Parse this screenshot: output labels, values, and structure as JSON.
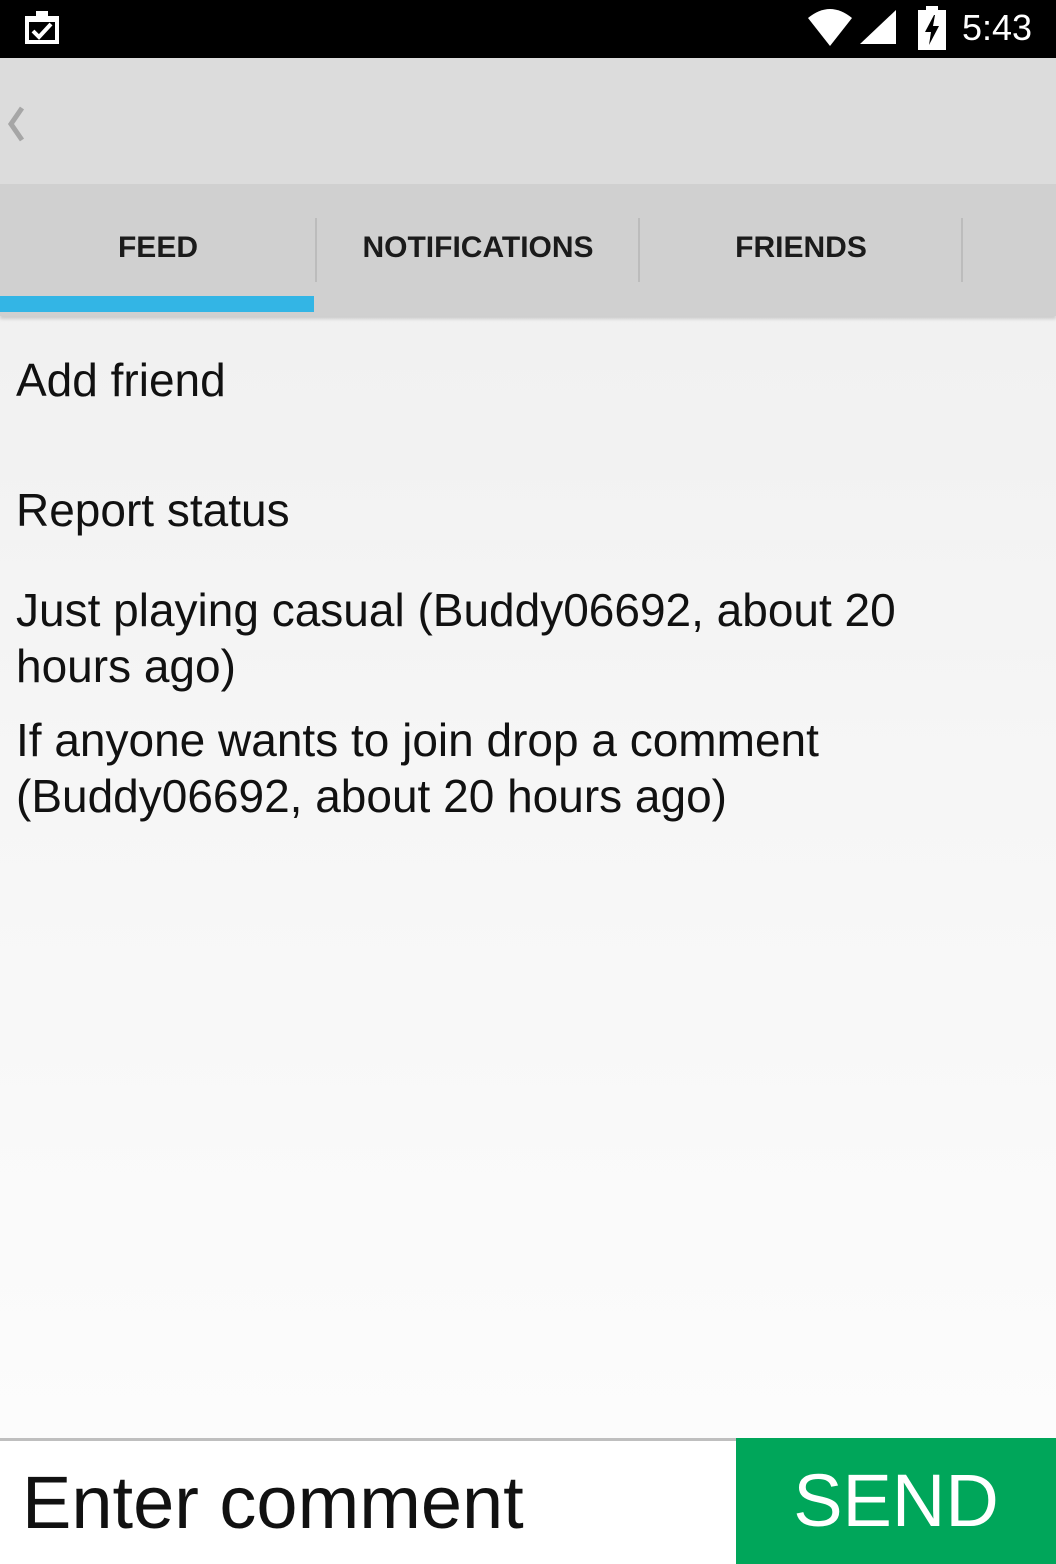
{
  "status_bar": {
    "time": "5:43",
    "icons": [
      "clipboard-check-icon",
      "wifi-icon",
      "signal-icon",
      "battery-charging-icon"
    ]
  },
  "action_bar": {
    "back_icon": "chevron-left-icon"
  },
  "tabs": [
    {
      "label": "FEED",
      "selected": true
    },
    {
      "label": "NOTIFICATIONS",
      "selected": false
    },
    {
      "label": "FRIENDS",
      "selected": false
    }
  ],
  "feed": {
    "items": [
      "Add friend",
      "Report status",
      "Just playing casual (Buddy06692, about 20 hours ago)",
      "If anyone wants to join drop a comment (Buddy06692, about 20 hours ago)"
    ]
  },
  "comment_bar": {
    "placeholder": "Enter comment",
    "send_label": "SEND"
  },
  "colors": {
    "tab_indicator": "#33b5e5",
    "send_button": "#00a65a",
    "status_bar": "#000000"
  }
}
